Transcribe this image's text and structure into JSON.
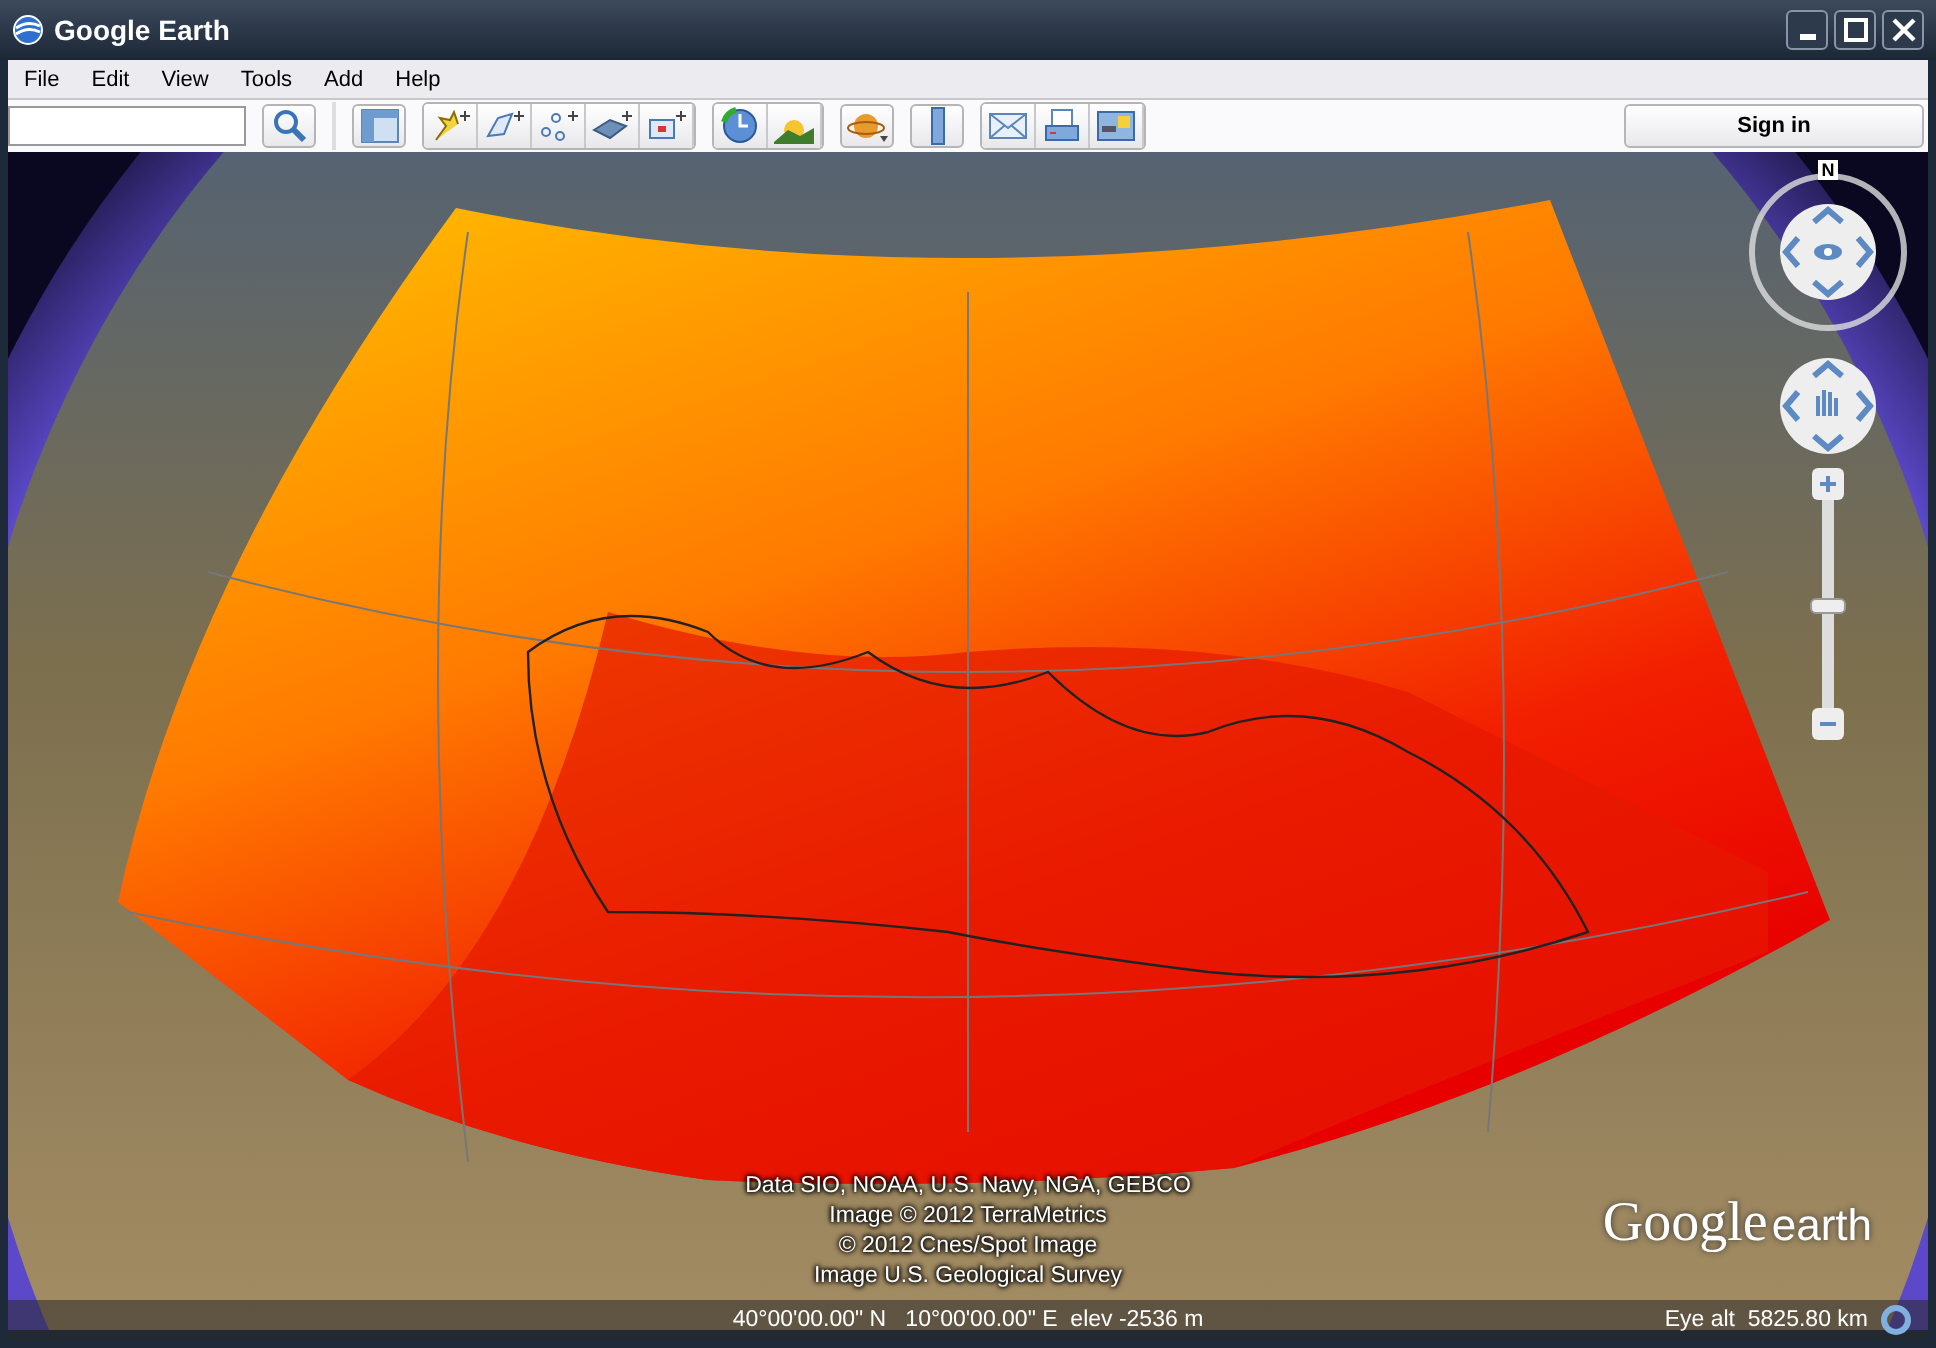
{
  "window": {
    "title": "Google Earth"
  },
  "menu": [
    "File",
    "Edit",
    "View",
    "Tools",
    "Add",
    "Help"
  ],
  "toolbar": {
    "sign_in": "Sign in"
  },
  "navigation": {
    "compass_label": "N",
    "zoom": {
      "level": 0.5
    }
  },
  "attribution": [
    "Data SIO, NOAA, U.S. Navy, NGA, GEBCO",
    "Image © 2012 TerraMetrics",
    "© 2012 Cnes/Spot Image",
    "Image U.S. Geological Survey"
  ],
  "logo": {
    "google": "Google",
    "earth": "earth"
  },
  "status_bar": {
    "position": "40°00'00.00\" N   10°00'00.00\" E  elev -2536 m",
    "eye_alt": "Eye alt  5825.80 km"
  }
}
